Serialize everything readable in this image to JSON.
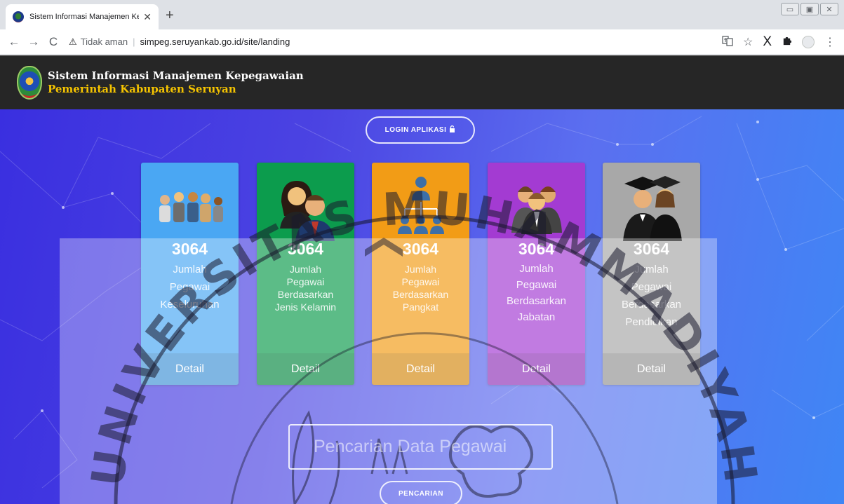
{
  "browser": {
    "tab_title": "Sistem Informasi Manajemen Kepeg",
    "tab_close": "✕",
    "new_tab": "+",
    "back": "←",
    "forward": "→",
    "reload": "C",
    "security_icon": "⚠",
    "security_label": "Tidak aman",
    "separator": "|",
    "url": "simpeg.seruyankab.go.id/site/landing",
    "window_controls": [
      "▭",
      "▣",
      "✕"
    ]
  },
  "header": {
    "title_line1": "Sistem Informasi Manajemen Kepegawaian",
    "title_line2": "Pemerintah Kabupaten Seruyan"
  },
  "login_button": {
    "label": "LOGIN APLIKASI",
    "icon": "lock-icon"
  },
  "cards": [
    {
      "count": "3064",
      "desc": [
        "Jumlah",
        "Pegawai",
        "Keseluruhan"
      ],
      "detail": "Detail",
      "color": "#4aa7f3",
      "icon": "employees-group-icon"
    },
    {
      "count": "3064",
      "desc": [
        "Jumlah",
        "Pegawai",
        "Berdasarkan",
        "Jenis Kelamin"
      ],
      "detail": "Detail",
      "color": "#0c9c4d",
      "icon": "gender-icon"
    },
    {
      "count": "3064",
      "desc": [
        "Jumlah",
        "Pegawai",
        "Berdasarkan",
        "Pangkat"
      ],
      "detail": "Detail",
      "color": "#f29c16",
      "icon": "hierarchy-icon"
    },
    {
      "count": "3064",
      "desc": [
        "Jumlah",
        "Pegawai",
        "Berdasarkan",
        "Jabatan"
      ],
      "detail": "Detail",
      "color": "#a33bd2",
      "icon": "team-position-icon"
    },
    {
      "count": "3064",
      "desc": [
        "Jumlah",
        "Pegawai",
        "Berdasarkan",
        "Pendidikan"
      ],
      "detail": "Detail",
      "color": "#a8a8a8",
      "icon": "graduate-icon"
    }
  ],
  "search": {
    "placeholder": "Pencarian Data Pegawai",
    "button_label": "PENCARIAN"
  },
  "watermark": {
    "text": "UNIVERSITAS MUHAMMADIYAH"
  },
  "colors": {
    "header_bg": "#262626",
    "brand_yellow": "#f5c400",
    "hero_start": "#3a2fe0",
    "hero_end": "#3f86f5"
  }
}
